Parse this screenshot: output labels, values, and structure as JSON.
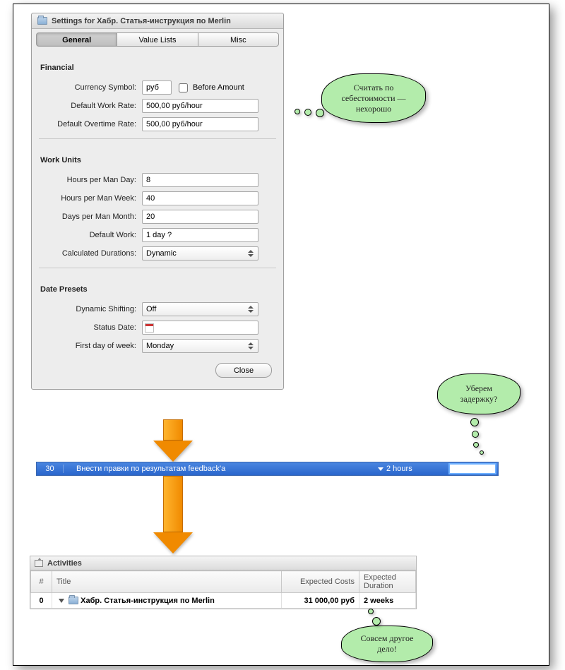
{
  "window": {
    "title": "Settings for Хабр. Статья-инструкция по Merlin",
    "tabs": {
      "general": "General",
      "value_lists": "Value Lists",
      "misc": "Misc"
    },
    "close": "Close"
  },
  "financial": {
    "heading": "Financial",
    "currency_symbol_label": "Currency Symbol:",
    "currency_symbol": "руб",
    "before_amount_label": "Before Amount",
    "default_work_rate_label": "Default Work Rate:",
    "default_work_rate": "500,00 руб/hour",
    "default_overtime_rate_label": "Default Overtime Rate:",
    "default_overtime_rate": "500,00 руб/hour"
  },
  "work_units": {
    "heading": "Work Units",
    "hours_per_man_day_label": "Hours per Man Day:",
    "hours_per_man_day": "8",
    "hours_per_man_week_label": "Hours per Man Week:",
    "hours_per_man_week": "40",
    "days_per_man_month_label": "Days per Man Month:",
    "days_per_man_month": "20",
    "default_work_label": "Default Work:",
    "default_work": "1 day ?",
    "calc_durations_label": "Calculated Durations:",
    "calc_durations": "Dynamic"
  },
  "date_presets": {
    "heading": "Date Presets",
    "dynamic_shifting_label": "Dynamic Shifting:",
    "dynamic_shifting": "Off",
    "status_date_label": "Status Date:",
    "status_date": "",
    "first_day_label": "First day of week:",
    "first_day": "Monday"
  },
  "callouts": {
    "c1": "Считать по себестоимости — нехорошо",
    "c2": "Уберем задержку?",
    "c3": "Совсем другое дело!"
  },
  "taskrow": {
    "number": "30",
    "title": "Внести правки по результатам feedback'а",
    "duration": "2 hours",
    "input_value": ""
  },
  "activities": {
    "heading": "Activities",
    "columns": {
      "num": "#",
      "title": "Title",
      "expected_costs": "Expected Costs",
      "expected_duration": "Expected Duration"
    },
    "row": {
      "num": "0",
      "title": "Хабр. Статья-инструкция по Merlin",
      "costs": "31 000,00 руб",
      "duration": "2 weeks"
    }
  }
}
